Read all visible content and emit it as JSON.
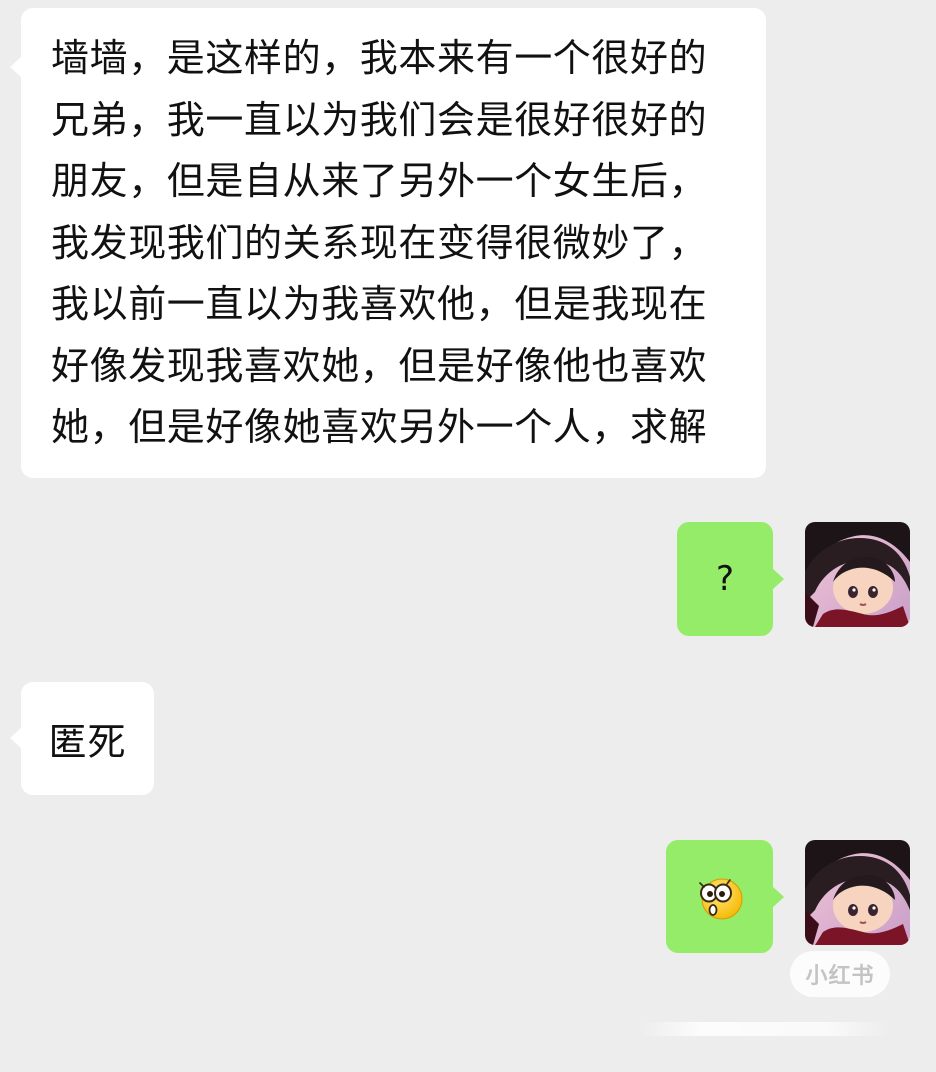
{
  "messages": [
    {
      "side": "left",
      "lines": [
        "墙墙，是这样的，我本来有一个很好的",
        "兄弟，我一直以为我们会是很好很好的",
        "朋友，但是自从来了另外一个女生后，",
        "我发现我们的关系现在变得很微妙了，",
        "我以前一直以为我喜欢他，但是我现在",
        "好像发现我喜欢她，但是好像他也喜欢",
        "她，但是好像她喜欢另外一个人，求解"
      ]
    },
    {
      "side": "right",
      "text": "?"
    },
    {
      "side": "left",
      "text": "匿死"
    },
    {
      "side": "right",
      "icon": "shocked-face-emoji"
    }
  ],
  "colors": {
    "background": "#ededed",
    "incoming_bubble": "#ffffff",
    "outgoing_bubble": "#95ec69"
  },
  "avatar": {
    "icon": "anime-character-avatar"
  },
  "watermark": {
    "text": "小红书"
  }
}
